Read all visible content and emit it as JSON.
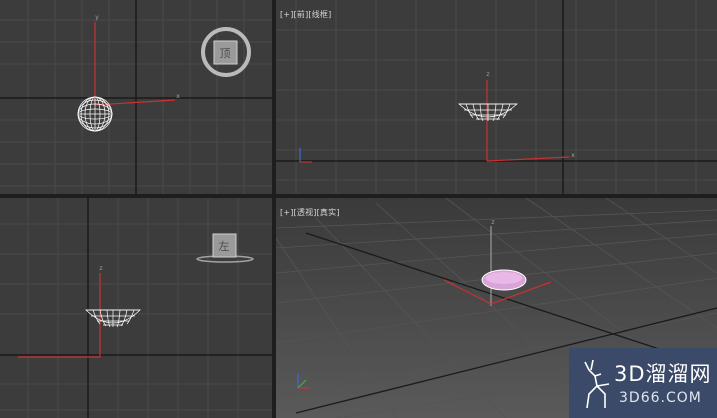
{
  "viewports": {
    "top": {
      "name": "Top",
      "cube_face": "顶"
    },
    "front": {
      "label_plus": "[+]",
      "label_view": "[前]",
      "label_shading": "[线框]"
    },
    "left": {
      "name": "Left",
      "cube_face": "左"
    },
    "perspective": {
      "label_plus": "[+]",
      "label_view": "[透视]",
      "label_shading": "[真实]"
    }
  },
  "axis_labels": {
    "x": "x",
    "y": "y",
    "z": "z"
  },
  "watermark": {
    "title": "3D溜溜网",
    "url": "3D66.COM"
  },
  "colors": {
    "viewport_bg": "#3c3c3c",
    "grid": "#4a4a4a",
    "axis_dark": "#1a1a1a",
    "active_border": "#c8a63c",
    "x_axis": "#c83232",
    "object_wire": "#ffffff",
    "object_fill": "#d9a5d8"
  },
  "icons": [
    "view-cube-icon",
    "axis-tripod-icon",
    "deer-logo-icon"
  ]
}
